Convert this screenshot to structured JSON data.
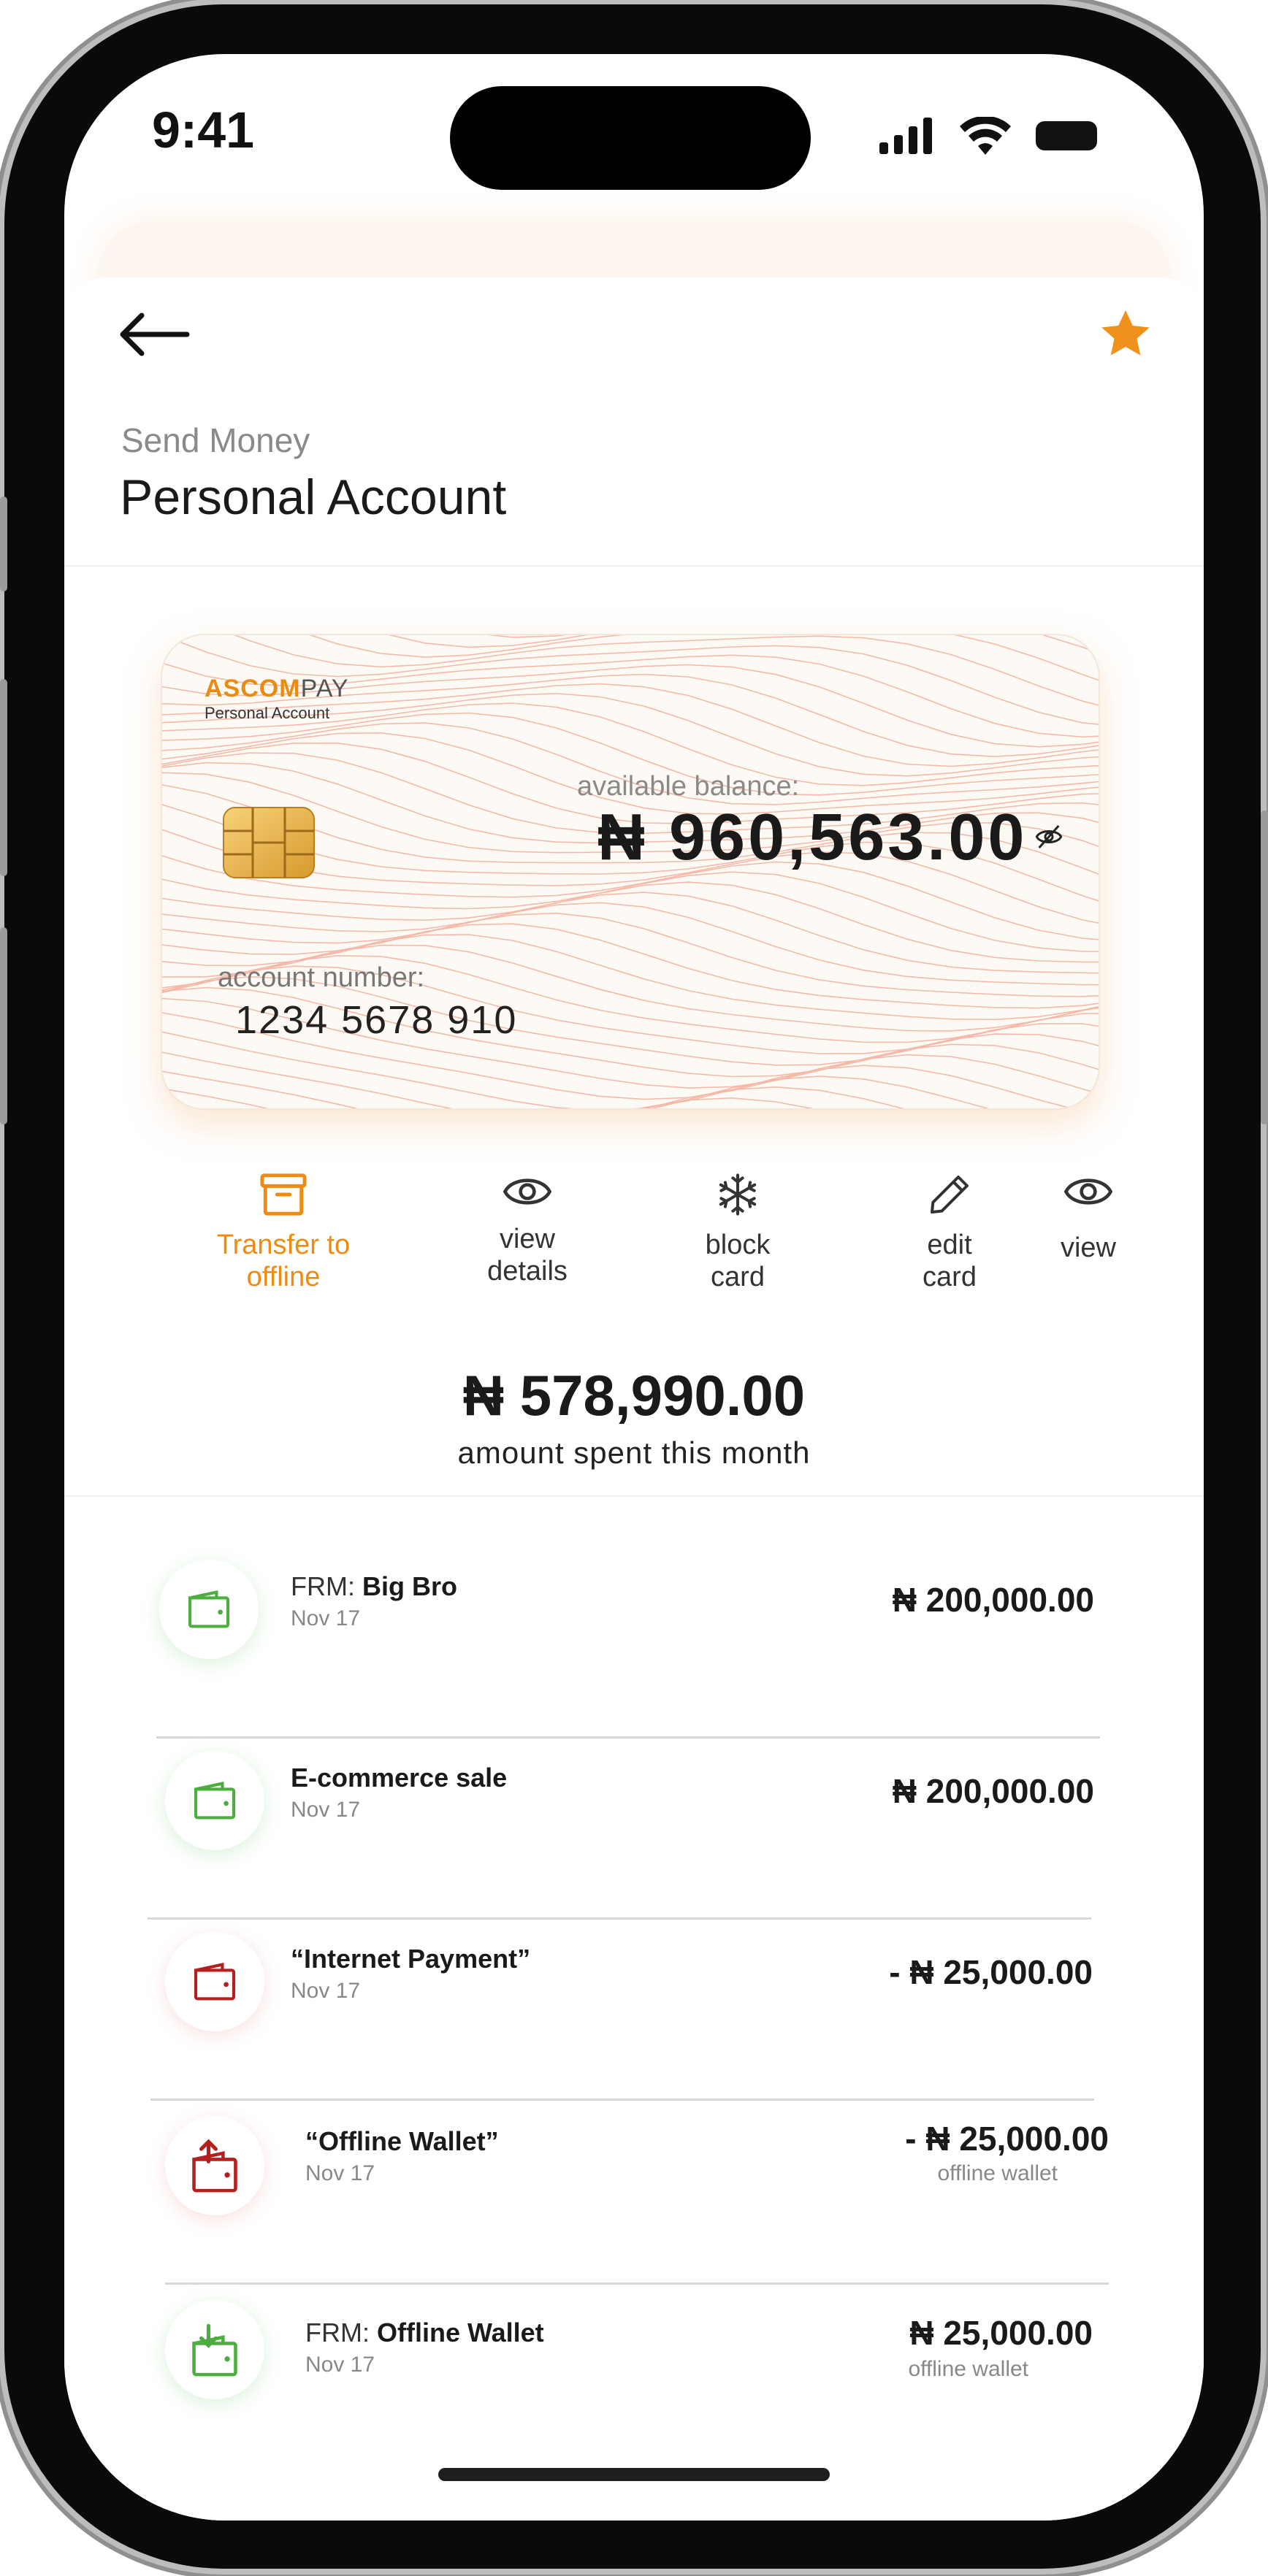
{
  "status_bar": {
    "time": "9:41"
  },
  "header": {
    "subtitle": "Send Money",
    "title": "Personal Account"
  },
  "card": {
    "brand_primary": "ASCOM",
    "brand_secondary": "PAY",
    "brand_sub": "Personal Account",
    "balance_label": "available balance:",
    "balance": "₦ 960,563.00",
    "account_label": "account number:",
    "account_number": "1234 5678 910"
  },
  "actions": [
    {
      "label_line1": "Transfer to",
      "label_line2": "offline",
      "icon": "archive-box-icon",
      "active": true
    },
    {
      "label_line1": "view",
      "label_line2": "details",
      "icon": "eye-icon",
      "active": false
    },
    {
      "label_line1": "block",
      "label_line2": "card",
      "icon": "snowflake-icon",
      "active": false
    },
    {
      "label_line1": "edit",
      "label_line2": "card",
      "icon": "pencil-icon",
      "active": false
    },
    {
      "label_line1": "view",
      "label_line2": "",
      "icon": "eye-icon",
      "active": false
    }
  ],
  "spending": {
    "amount": "₦ 578,990.00",
    "label": "amount spent this month"
  },
  "transactions": [
    {
      "prefix": "FRM: ",
      "name": "Big Bro",
      "date": "Nov 17",
      "amount": "₦ 200,000.00",
      "note": "",
      "icon": "wallet-icon",
      "color": "#4cae3f"
    },
    {
      "prefix": "",
      "name": "E-commerce sale",
      "date": "Nov 17",
      "amount": "₦ 200,000.00",
      "note": "",
      "icon": "wallet-icon",
      "color": "#4cae3f"
    },
    {
      "prefix": "",
      "name": "“Internet Payment”",
      "date": "Nov 17",
      "amount": "- ₦ 25,000.00",
      "note": "",
      "icon": "wallet-icon",
      "color": "#b3201f"
    },
    {
      "prefix": "",
      "name": "“Offline Wallet”",
      "date": "Nov 17",
      "amount": "- ₦ 25,000.00",
      "note": "offline wallet",
      "icon": "wallet-upload-icon",
      "color": "#b3201f"
    },
    {
      "prefix": "FRM: ",
      "name": "Offline Wallet",
      "date": "Nov 17",
      "amount": "₦ 25,000.00",
      "note": "offline wallet",
      "icon": "wallet-download-icon",
      "color": "#4cae3f"
    }
  ],
  "colors": {
    "accent": "#ee8b12",
    "income": "#4cae3f",
    "expense": "#b3201f"
  }
}
